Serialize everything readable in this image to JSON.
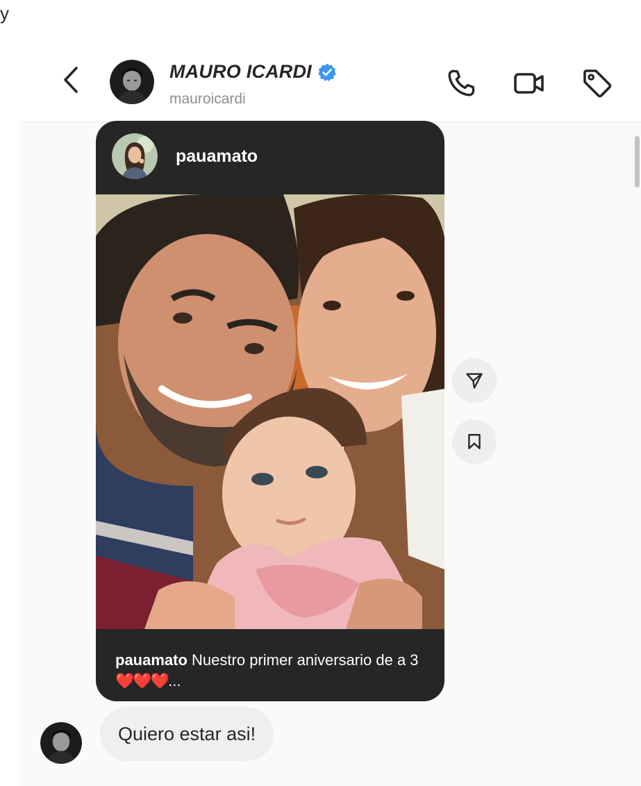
{
  "corner": {
    "glyph": "y"
  },
  "header": {
    "back_icon": "chevron-left-icon",
    "contact_name": "MAURO ICARDI",
    "verified": true,
    "verified_color": "#3897f0",
    "handle": "mauroicardi",
    "actions": [
      "phone-icon",
      "video-camera-icon",
      "tag-icon"
    ]
  },
  "shared_post": {
    "author": "pauamato",
    "caption": {
      "username": "pauamato",
      "text": "Nuestro primer aniversario de a 3",
      "emoji": "❤️❤️❤️",
      "ellipsis": "..."
    }
  },
  "side_actions": [
    "send-icon",
    "bookmark-icon"
  ],
  "message": {
    "text": "Quiero estar asi!"
  },
  "colors": {
    "card_bg": "#262626",
    "bubble_bg": "#efefef",
    "heart": "#e02424"
  }
}
